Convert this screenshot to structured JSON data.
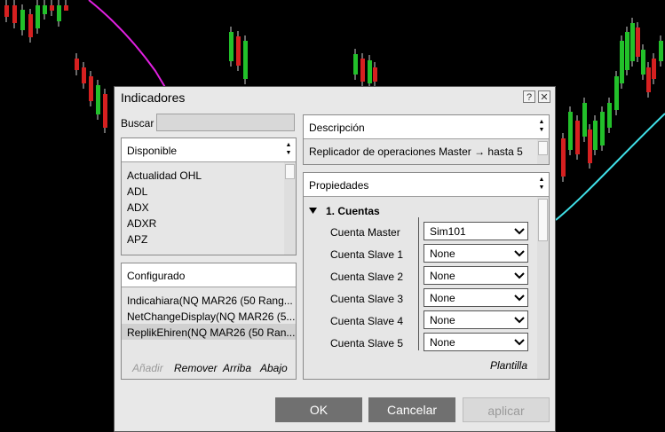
{
  "dialog": {
    "title": "Indicadores",
    "help_label": "?",
    "close_label": "✕"
  },
  "search": {
    "label": "Buscar",
    "value": ""
  },
  "available": {
    "header": "Disponible",
    "items": [
      "Actualidad OHL",
      "ADL",
      "ADX",
      "ADXR",
      "APZ"
    ]
  },
  "configured": {
    "header": "Configurado",
    "items": [
      "Indicahiara(NQ MAR26 (50 Rang...",
      "NetChangeDisplay(NQ MAR26 (5...",
      "ReplikEhiren(NQ MAR26 (50 Ran..."
    ],
    "selected_index": 2,
    "actions": {
      "add": "Añadir",
      "remove": "Remover",
      "up": "Arriba",
      "down": "Abajo"
    }
  },
  "description": {
    "header": "Descripción",
    "text": "Replicador de operaciones Master → hasta 5"
  },
  "properties": {
    "header": "Propiedades",
    "group": "1. Cuentas",
    "rows": [
      {
        "label": "Cuenta Master",
        "value": "Sim101"
      },
      {
        "label": "Cuenta Slave 1",
        "value": "None"
      },
      {
        "label": "Cuenta Slave 2",
        "value": "None"
      },
      {
        "label": "Cuenta Slave 3",
        "value": "None"
      },
      {
        "label": "Cuenta Slave 4",
        "value": "None"
      },
      {
        "label": "Cuenta Slave 5",
        "value": "None"
      }
    ],
    "template_label": "Plantilla"
  },
  "buttons": {
    "ok": "OK",
    "cancel": "Cancelar",
    "apply": "aplicar"
  },
  "colors": {
    "candle_up": "#22c02a",
    "candle_down": "#d62020",
    "ma_magenta": "#e020e0",
    "ma_cyan": "#40e0e8",
    "button_bg": "#707070",
    "button_text": "#ffffff"
  }
}
